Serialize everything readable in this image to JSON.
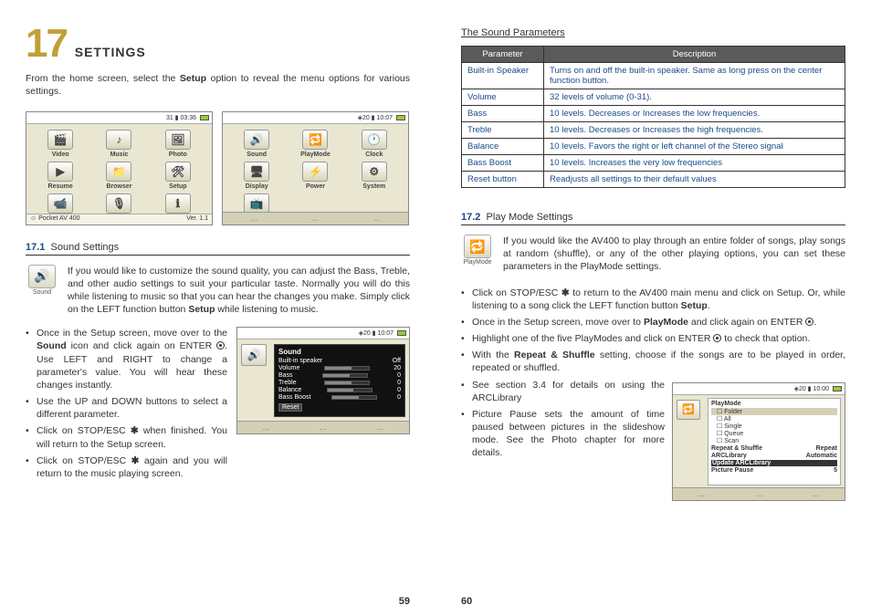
{
  "chapter": {
    "num": "17",
    "title": "SETTINGS"
  },
  "intro_pre": "From the home screen, select the ",
  "intro_bold": "Setup",
  "intro_post": " option to reveal the menu options for various settings.",
  "home_screen": {
    "status": "31 ▮ 03:36",
    "icons": [
      "Video",
      "Music",
      "Photo",
      "Resume",
      "Browser",
      "Setup",
      "VideoCorder",
      "AudioCorder",
      "Info"
    ],
    "footer_left": "☺ Pocket AV 400",
    "footer_right": "Ver. 1.1"
  },
  "setup_screen": {
    "status": "◈20 ▮ 10:07",
    "icons": [
      "Sound",
      "PlayMode",
      "Clock",
      "Display",
      "Power",
      "System",
      "TV control"
    ]
  },
  "s171": {
    "num": "17.1",
    "title": "Sound Settings",
    "icon_label": "Sound",
    "body_pre": "If you would like to customize the sound quality, you can adjust the Bass, Treble, and other audio settings to suit your particular taste. Normally you will do this while listening to music so that you can hear the changes you make. Simply click on the LEFT function button ",
    "body_bold": "Setup",
    "body_post": " while listening to music.",
    "bullets": [
      {
        "pre": "Once in the Setup screen, move over to the ",
        "b1": "Sound",
        "mid": " icon and click again on ENTER ",
        "post": ". Use LEFT and RIGHT to change a parameter's value. You will hear these changes instantly."
      },
      {
        "text": "Use the UP and DOWN buttons to select a different parameter."
      },
      {
        "pre": "Click on STOP/ESC ",
        "post": " when finished. You will return to the Setup screen.",
        "esc": true
      },
      {
        "pre": "Click on STOP/ESC ",
        "post": " again and you will return to the music playing screen.",
        "esc": true
      }
    ],
    "panel": {
      "status": "◈20 ▮ 10:07",
      "title": "Sound",
      "rows": [
        {
          "label": "Built-in speaker",
          "value": "Off"
        },
        {
          "label": "Volume",
          "value": "20"
        },
        {
          "label": "Bass",
          "value": "0"
        },
        {
          "label": "Treble",
          "value": "0"
        },
        {
          "label": "Balance",
          "value": "0"
        },
        {
          "label": "Bass Boost",
          "value": "0"
        }
      ],
      "reset": "Reset"
    }
  },
  "params": {
    "heading": "The Sound Parameters",
    "cols": [
      "Parameter",
      "Description"
    ],
    "rows": [
      [
        "Built-in Speaker",
        "Turns on and off the built-in speaker. Same as long press on the center function button."
      ],
      [
        "Volume",
        "32 levels of volume (0-31)."
      ],
      [
        "Bass",
        "10 levels. Decreases or Increases the low frequencies."
      ],
      [
        "Treble",
        "10 levels. Decreases or Increases the high frequencies."
      ],
      [
        "Balance",
        "10 levels. Favors the right or left channel of the Stereo signal"
      ],
      [
        "Bass Boost",
        "10 levels. Increases the very low frequencies"
      ],
      [
        "Reset button",
        "Readjusts all settings to their default values"
      ]
    ]
  },
  "s172": {
    "num": "17.2",
    "title": "Play Mode Settings",
    "icon_label": "PlayMode",
    "body": "If you would like the AV400 to play through an entire folder of songs, play songs at random (shuffle), or any of the other playing options, you can set these parameters in the PlayMode settings.",
    "bullets": [
      {
        "pre": "Click on STOP/ESC ",
        "esc": true,
        "mid": " to return to the AV400 main menu and click on Setup. Or, while listening to a song click the LEFT function button ",
        "b1": "Setup",
        "post": "."
      },
      {
        "pre": "Once in the Setup screen, move over to ",
        "b1": "PlayMode",
        "mid": " and click again on ENTER ",
        "enter": true,
        "post": "."
      },
      {
        "pre": "Highlight one of the five PlayModes and click on ENTER ",
        "enter": true,
        "post": " to check that option."
      },
      {
        "pre": "With the ",
        "b1": "Repeat & Shuffle",
        "post": " setting, choose if the songs are to be played in order, repeated or shuffled."
      },
      {
        "text": "See section 3.4 for details on using the ARCLibrary"
      },
      {
        "text": "Picture Pause sets the amount of time paused between pictures in the slideshow mode. See the Photo chapter for more details."
      }
    ],
    "panel": {
      "status": "◈20 ▮ 10:00",
      "title": "PlayMode",
      "modes": [
        "Folder",
        "All",
        "Single",
        "Queue",
        "Scan"
      ],
      "rows": [
        [
          "Repeat & Shuffle",
          "Repeat"
        ],
        [
          "ARCLibrary",
          "Automatic"
        ],
        [
          "Update ARCLibrary",
          ""
        ],
        [
          "Picture Pause",
          "5"
        ]
      ]
    }
  },
  "pages": {
    "left": "59",
    "right": "60"
  }
}
